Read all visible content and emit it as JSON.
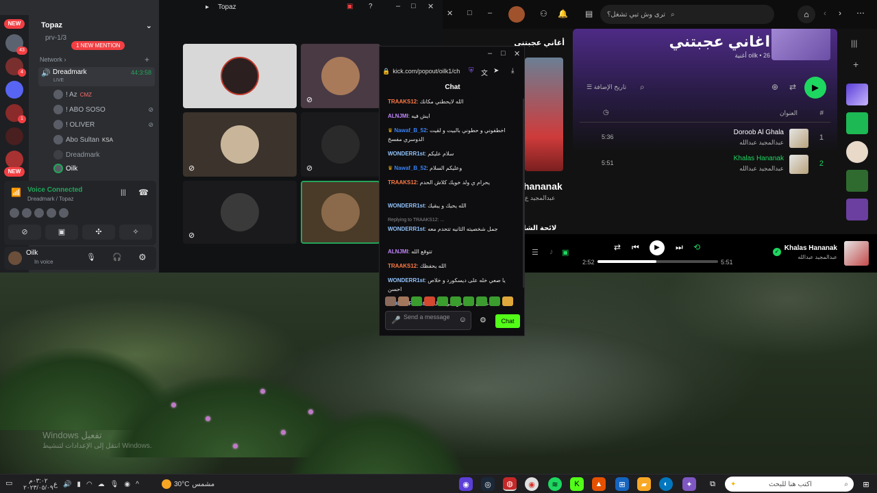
{
  "discord": {
    "server_name": "Topaz",
    "new_label": "NEW",
    "channel_prev": "prv-1/3",
    "new_mention": "1 NEW MENTION",
    "category": "Network",
    "voice_channel": "Dreadmark",
    "voice_timer": "44:3:58",
    "live_label": "LIVE",
    "server_badge_43": "43",
    "server_badge_4": "4",
    "server_badge_1": "1",
    "members": [
      {
        "name": "! Az",
        "tag": "CMZ"
      },
      {
        "name": "! ABO SOSO",
        "tag": ""
      },
      {
        "name": "! OLIVER",
        "tag": ""
      },
      {
        "name": "Abo Sultan",
        "tag": "KSA"
      },
      {
        "name": "Dreadmark",
        "tag": ""
      },
      {
        "name": "Oilk",
        "tag": ""
      }
    ],
    "voice_connected": "Voice Connected",
    "voice_location": "Dreadmark / Topaz",
    "username": "Oilk",
    "user_status": "In voice"
  },
  "topaz": {
    "title": "Topaz"
  },
  "kick": {
    "url": "kick.com/popout/oilk1/ch",
    "chat_title": "Chat",
    "messages": [
      {
        "user": "TRAAKS12",
        "text": "الله لايحطني مكانك",
        "color": "#ff7a45"
      },
      {
        "user": "ALNJMI",
        "text": "ايش فيه",
        "color": "#c084fc"
      },
      {
        "user": "Nawaf_B_52",
        "text": "اخطفوني و حطوني بالبيت و لقيت الدوسري مفسخ",
        "color": "#3b82f6",
        "crown": true
      },
      {
        "user": "WONDERR1st",
        "text": "سلام عليكم",
        "color": "#93c5fd"
      },
      {
        "user": "Nawaf_B_52",
        "text": "وعليكم السلام",
        "color": "#3b82f6",
        "crown": true
      },
      {
        "user": "TRAAKS12",
        "text": "يحرام ي ولد خويك كلاش الحدم",
        "color": "#ff7a45"
      },
      {
        "user": "WONDERR1st",
        "text": "الله يحيك و يبقيك",
        "color": "#93c5fd"
      },
      {
        "user": "WONDERR1st",
        "text": "جمل شخصيته الثانيه تتحدم معه",
        "color": "#93c5fd",
        "reply": "Replying to TRAAKS12: ..."
      },
      {
        "user": "ALNJMI",
        "text": "تتوقع الله",
        "color": "#c084fc"
      },
      {
        "user": "TRAAKS12",
        "text": "الله يحفظك",
        "color": "#ff7a45"
      },
      {
        "user": "WONDERR1st",
        "text": "يا صعي خله على ديسكورد و خلاص احسن",
        "color": "#93c5fd"
      },
      {
        "user": "WONDERR1st",
        "text": "عشان ما تتاخر على صالحك",
        "color": "#93c5fd"
      }
    ],
    "input_placeholder": "Send a message",
    "send_label": "Chat"
  },
  "spotify": {
    "search_placeholder": "ترى وش تبي تشغل؟",
    "playlist_title": "اغاني عجبتني",
    "playlist_meta": "oilk • 26 أغنية",
    "sort_label": "تاريخ الإضافة",
    "col_title": "العنوان",
    "col_num": "#",
    "left_title": "أغاني عجبتني",
    "left_track": "hananak",
    "left_artist": "عبدالمجيد ع",
    "left_footer": "لائحة الشا",
    "tracks": [
      {
        "num": "1",
        "name": "Doroob Al Ghala",
        "artist": "عبدالمجيد عبدالله",
        "duration": "5:36",
        "active": false
      },
      {
        "num": "2",
        "name": "Khalas Hananak",
        "artist": "عبدالمجيد عبدالله",
        "duration": "5:51",
        "active": true
      }
    ],
    "now_playing_title": "Khalas Hananak",
    "now_playing_artist": "عبدالمجيد عبدالله",
    "elapsed": "2:52",
    "total": "5:51",
    "progress": 0.49,
    "accent": "#1ed760"
  },
  "desktop": {
    "watermark_1": "Windows تفعيل",
    "watermark_2": "انتقل إلى الإعدادات لتنشيط Windows."
  },
  "taskbar": {
    "search_placeholder": "اكتب هنا للبحث",
    "weather_temp": "30°C",
    "weather_label": "مشمس",
    "time": "٠٣:٠٢م",
    "date": "٢٠٢٣/٠٥/٠٩",
    "lang": "ع"
  }
}
